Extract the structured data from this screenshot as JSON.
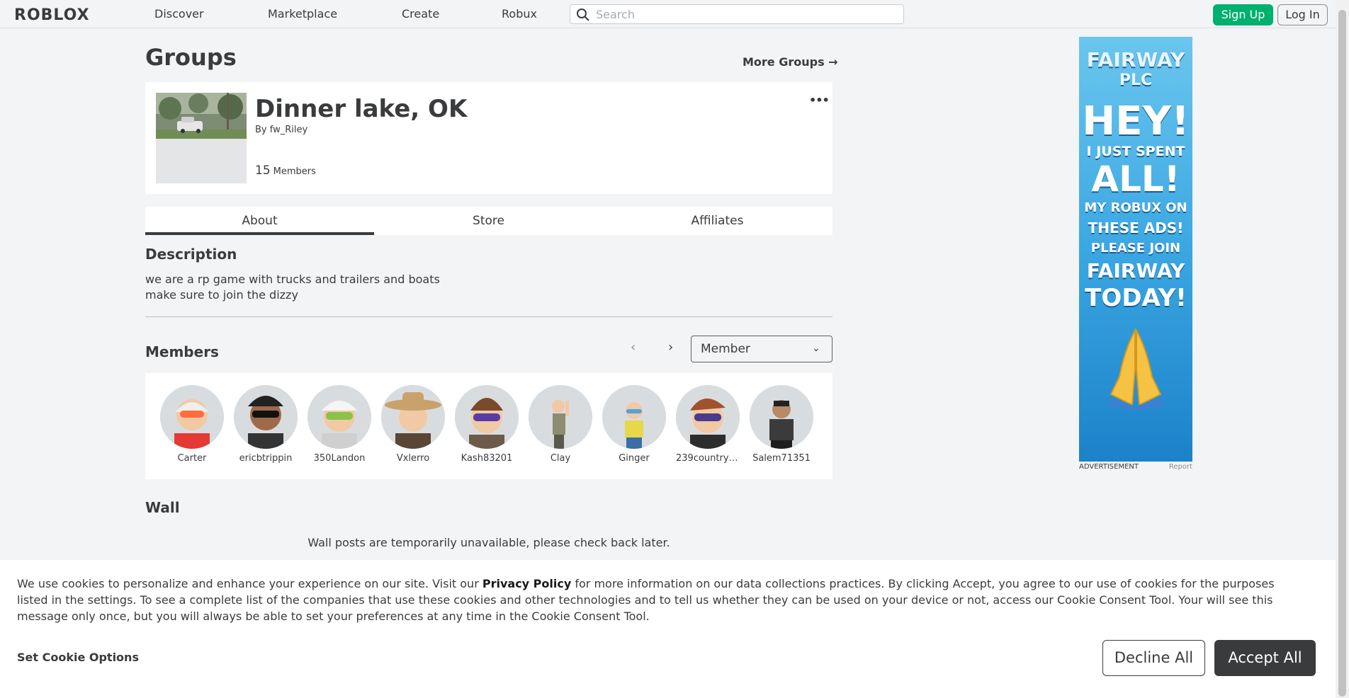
{
  "nav": {
    "logo": "ROBLOX",
    "links": [
      "Discover",
      "Marketplace",
      "Create",
      "Robux"
    ],
    "search_placeholder": "Search",
    "signup": "Sign Up",
    "login": "Log In"
  },
  "page": {
    "title": "Groups",
    "more_groups": "More Groups →"
  },
  "group": {
    "name": "Dinner lake, OK",
    "by_prefix": "By",
    "owner": "fw_Riley",
    "member_count": "15",
    "member_label": "Members",
    "menu": "•••"
  },
  "tabs": [
    "About",
    "Store",
    "Affiliates"
  ],
  "description": {
    "title": "Description",
    "line1": "we are a rp game with trucks and trailers and boats",
    "line2": "make sure to join the dizzy"
  },
  "members": {
    "title": "Members",
    "prev": "‹",
    "next": "›",
    "role_selected": "Member",
    "chevron": "⌄",
    "list": [
      "Carter",
      "ericbtrippin",
      "350Landon",
      "Vxlerro",
      "Kash83201",
      "Clay",
      "Ginger",
      "239countryk...",
      "Salem71351"
    ]
  },
  "wall": {
    "title": "Wall",
    "notice": "Wall posts are temporarily unavailable, please check back later."
  },
  "ad": {
    "lines": [
      "FAIRWAY",
      "PLC",
      "HEY!",
      "I JUST SPENT",
      "ALL!",
      "MY ROBUX ON",
      "THESE ADS!",
      "PLEASE JOIN",
      "FAIRWAY",
      "TODAY!"
    ],
    "label": "ADVERTISEMENT",
    "report": "Report"
  },
  "cookie": {
    "text_before": "We use cookies to personalize and enhance your experience on our site. Visit our ",
    "privacy_link": "Privacy Policy",
    "text_after": " for more information on our data collections practices. By clicking Accept, you agree to our use of cookies for the purposes listed in the settings. To see a complete list of the companies that use these cookies and other technologies and to tell us whether they can be used on your device or not, access our Cookie Consent Tool. Your will see this message only once, but you will always be able to set your preferences at any time in the Cookie Consent Tool.",
    "set_options": "Set Cookie Options",
    "decline": "Decline All",
    "accept": "Accept All"
  },
  "colors": {
    "accent_green": "#00b06f",
    "text_dark": "#393b3d",
    "page_bg": "#f2f4f5"
  }
}
